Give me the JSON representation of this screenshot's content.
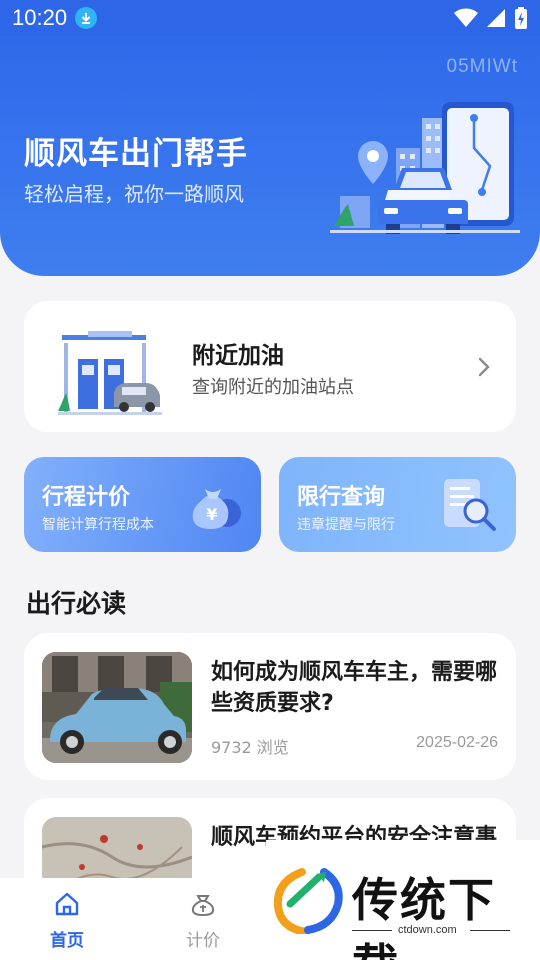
{
  "status_bar": {
    "time": "10:20"
  },
  "hero": {
    "code": "05MIWt",
    "title": "顺风车出门帮手",
    "subtitle": "轻松启程，祝你一路顺风"
  },
  "gas_card": {
    "title": "附近加油",
    "subtitle": "查询附近的加油站点"
  },
  "features": [
    {
      "title": "行程计价",
      "subtitle": "智能计算行程成本"
    },
    {
      "title": "限行查询",
      "subtitle": "违章提醒与限行"
    }
  ],
  "section_title": "出行必读",
  "articles": [
    {
      "title": "如何成为顺风车车主，需要哪些资质要求?",
      "views": "9732 浏览",
      "date": "2025-02-26"
    },
    {
      "title": "顺风车预约平台的安全注意事",
      "views": "",
      "date": ""
    }
  ],
  "tabs": [
    {
      "label": "首页",
      "active": true
    },
    {
      "label": "计价",
      "active": false
    }
  ],
  "watermark": {
    "brand": "传统下载",
    "url": "ctdown.com"
  },
  "colors": {
    "primary": "#2d67e8",
    "background": "#f4f4f6"
  }
}
